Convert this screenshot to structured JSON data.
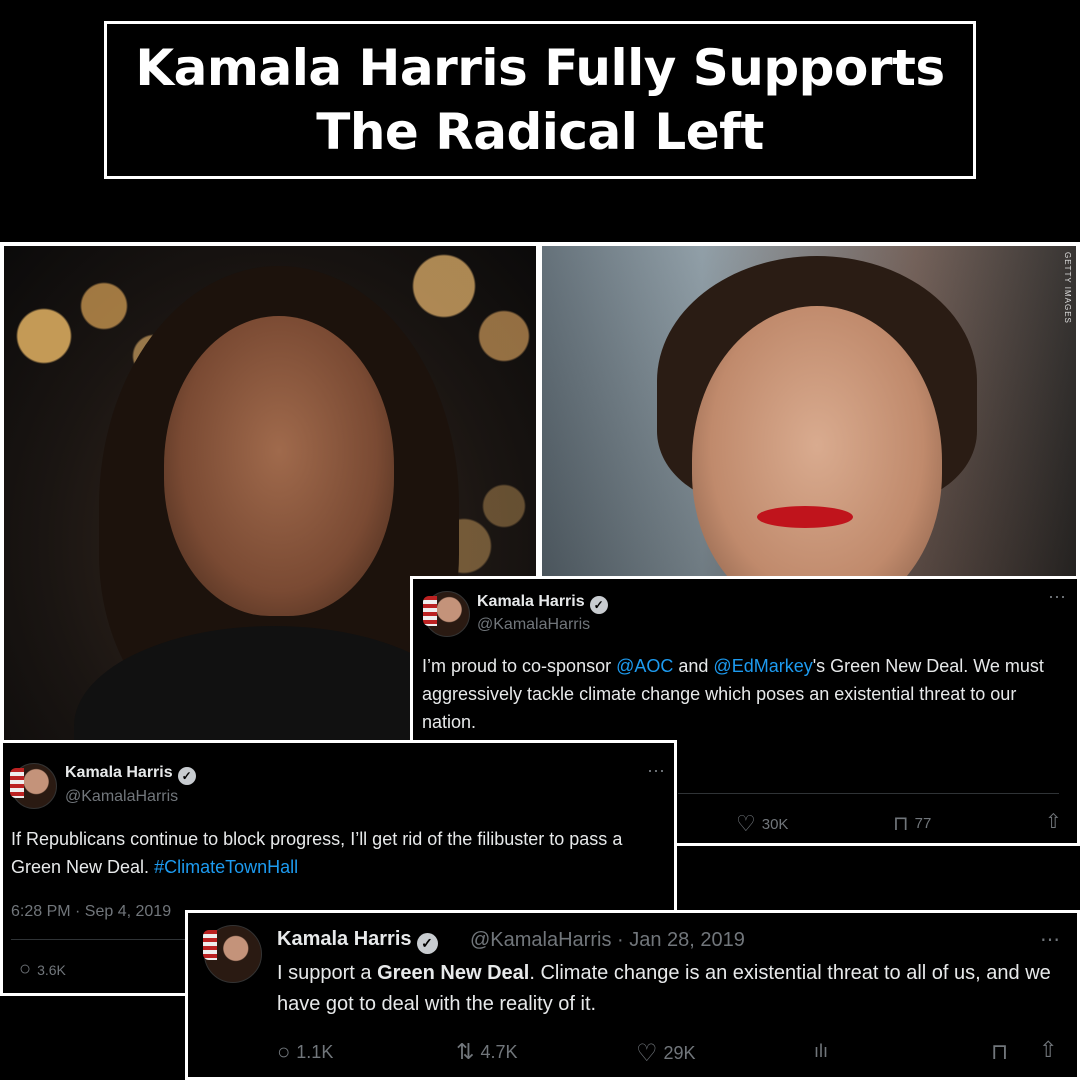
{
  "headline": {
    "line1": "Kamala Harris Fully Supports",
    "line2": "The Radical Left"
  },
  "photos": {
    "credit": "GETTY IMAGES"
  },
  "tweet_top_right": {
    "author": "Kamala Harris",
    "handle": "@KamalaHarris",
    "text_part1": "I’m proud to co-sponsor ",
    "mention1": "@AOC",
    "text_part2": " and ",
    "mention2": "@EdMarkey",
    "text_part3": "'s Green New Deal. We must aggressively tackle climate change which poses an existential threat to our nation.",
    "likes": "30K",
    "bookmarks": "77"
  },
  "tweet_middle_left": {
    "author": "Kamala Harris",
    "handle": "@KamalaHarris",
    "text_part1": "If Republicans continue to block progress, I’ll get rid of the filibuster to pass a Green New Deal. ",
    "hashtag": "#ClimateTownHall",
    "timestamp": "6:28 PM · Sep 4, 2019",
    "replies": "3.6K"
  },
  "tweet_bottom": {
    "author": "Kamala Harris",
    "handle_date": "@KamalaHarris · Jan 28, 2019",
    "text_part1": "I support a ",
    "bold": "Green New Deal",
    "text_part2": ". Climate change is an existential threat to all of us, and we have got to deal with the reality of it.",
    "replies": "1.1K",
    "reposts": "4.7K",
    "likes": "29K"
  },
  "icons": {
    "more": "⋯",
    "verified": "✓",
    "reply": "○",
    "repost": "⇅",
    "like": "♡",
    "views": "ılı",
    "bookmark": "⊓",
    "share": "⇧"
  }
}
